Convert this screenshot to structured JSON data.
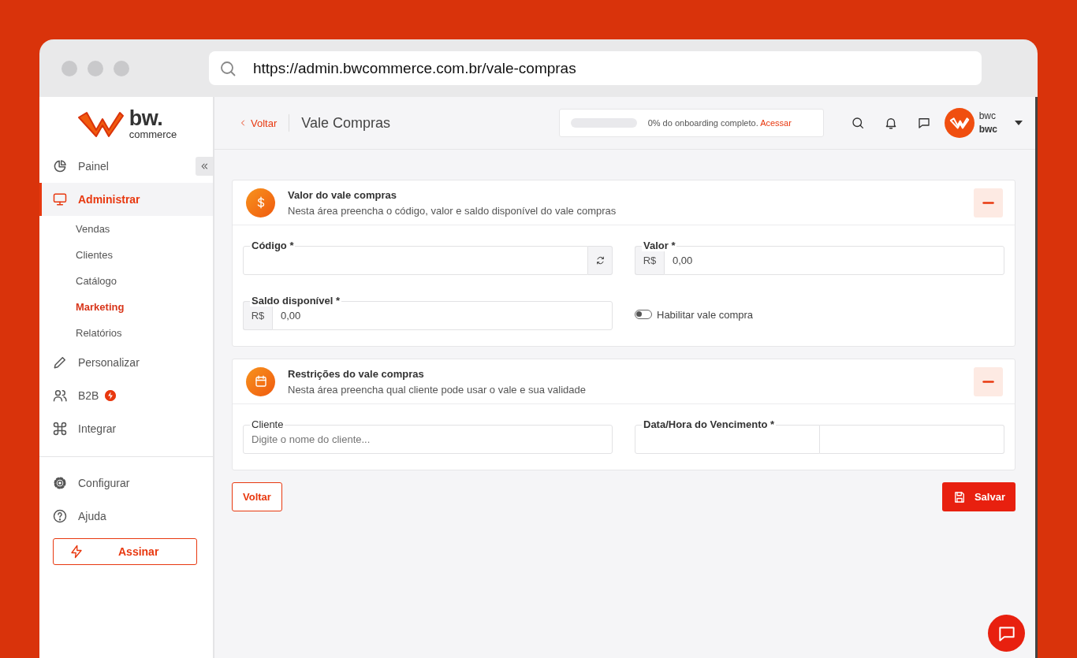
{
  "browser": {
    "url": "https://admin.bwcommerce.com.br/vale-compras"
  },
  "logo": {
    "wordmark": "bw.",
    "tagline": "commerce"
  },
  "sidebar": {
    "items": [
      {
        "label": "Painel",
        "selected": false
      },
      {
        "label": "Administrar",
        "selected": true,
        "children": [
          {
            "label": "Vendas",
            "selected": false
          },
          {
            "label": "Clientes",
            "selected": false
          },
          {
            "label": "Catálogo",
            "selected": false
          },
          {
            "label": "Marketing",
            "selected": true
          },
          {
            "label": "Relatórios",
            "selected": false
          }
        ]
      },
      {
        "label": "Personalizar",
        "selected": false
      },
      {
        "label": "B2B",
        "selected": false,
        "badge": true
      },
      {
        "label": "Integrar",
        "selected": false
      }
    ],
    "footer_items": [
      {
        "label": "Configurar",
        "selected": false
      },
      {
        "label": "Ajuda",
        "selected": false
      }
    ],
    "cta": "Assinar"
  },
  "header": {
    "back": "Voltar",
    "title": "Vale Compras",
    "onboarding": {
      "level": 0,
      "text": "0% do onboarding completo.",
      "link": "Acessar"
    },
    "user": {
      "line_1": "bwc",
      "line_2": "bwc"
    }
  },
  "cards": [
    {
      "title": "Valor do vale compras",
      "subtitle": "Nesta área preencha o código, valor e saldo disponível do vale compras",
      "expanded": true,
      "fields": [
        {
          "kind": "refresh",
          "label": "Código *"
        },
        {
          "kind": "currency",
          "label": "Valor *",
          "prefix": "R$",
          "value": "0,00"
        },
        {
          "kind": "currency",
          "label": "Saldo disponível *",
          "prefix": "R$",
          "value": "0,00"
        },
        {
          "kind": "toggle",
          "label": "Habilitar vale compra",
          "on": false
        }
      ]
    },
    {
      "title": "Restrições do vale compras",
      "subtitle": "Nesta área preencha qual cliente pode usar o vale e sua validade",
      "expanded": true,
      "fields": [
        {
          "kind": "search",
          "label": "Cliente",
          "placeholder": "Digite o nome do cliente..."
        },
        {
          "kind": "datetime",
          "label": "Data/Hora do Vencimento *"
        }
      ]
    }
  ],
  "actions": {
    "back": "Voltar",
    "save": "Salvar"
  }
}
